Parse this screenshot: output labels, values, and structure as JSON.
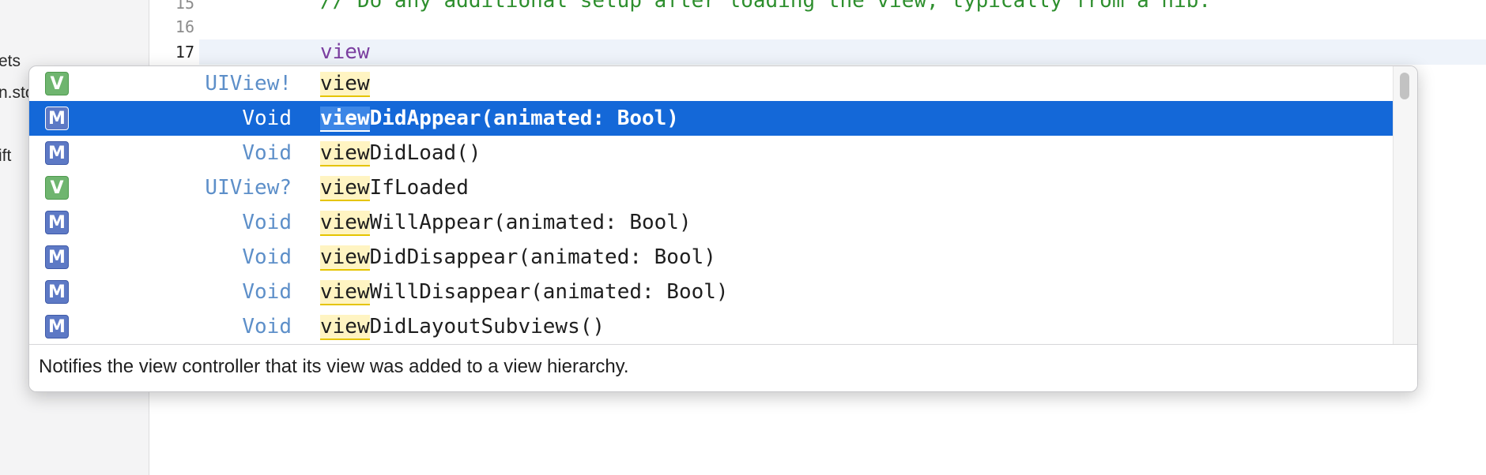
{
  "navigator": {
    "items": [
      "ets",
      "n.sto",
      "ift"
    ]
  },
  "gutter": {
    "lines": [
      "15",
      "16",
      "17"
    ]
  },
  "code": {
    "comment_line": "// Do any additional setup after loading the view, typically from a nib.",
    "current_line": "view"
  },
  "completion": {
    "query": "view",
    "items": [
      {
        "kind": "V",
        "type": "UIView!",
        "match": "view",
        "rest": ""
      },
      {
        "kind": "M",
        "type": "Void",
        "match": "view",
        "rest": "DidAppear(animated: Bool)"
      },
      {
        "kind": "M",
        "type": "Void",
        "match": "view",
        "rest": "DidLoad()"
      },
      {
        "kind": "V",
        "type": "UIView?",
        "match": "view",
        "rest": "IfLoaded"
      },
      {
        "kind": "M",
        "type": "Void",
        "match": "view",
        "rest": "WillAppear(animated: Bool)"
      },
      {
        "kind": "M",
        "type": "Void",
        "match": "view",
        "rest": "DidDisappear(animated: Bool)"
      },
      {
        "kind": "M",
        "type": "Void",
        "match": "view",
        "rest": "WillDisappear(animated: Bool)"
      },
      {
        "kind": "M",
        "type": "Void",
        "match": "view",
        "rest": "DidLayoutSubviews()"
      }
    ],
    "selected_index": 1,
    "description": "Notifies the view controller that its view was added to a view hierarchy."
  },
  "colors": {
    "selection": "#1468d8",
    "variable_badge": "#6fb56f",
    "method_badge": "#5d79c5",
    "type_text": "#5d8fc9",
    "comment": "#2e8f2e"
  }
}
